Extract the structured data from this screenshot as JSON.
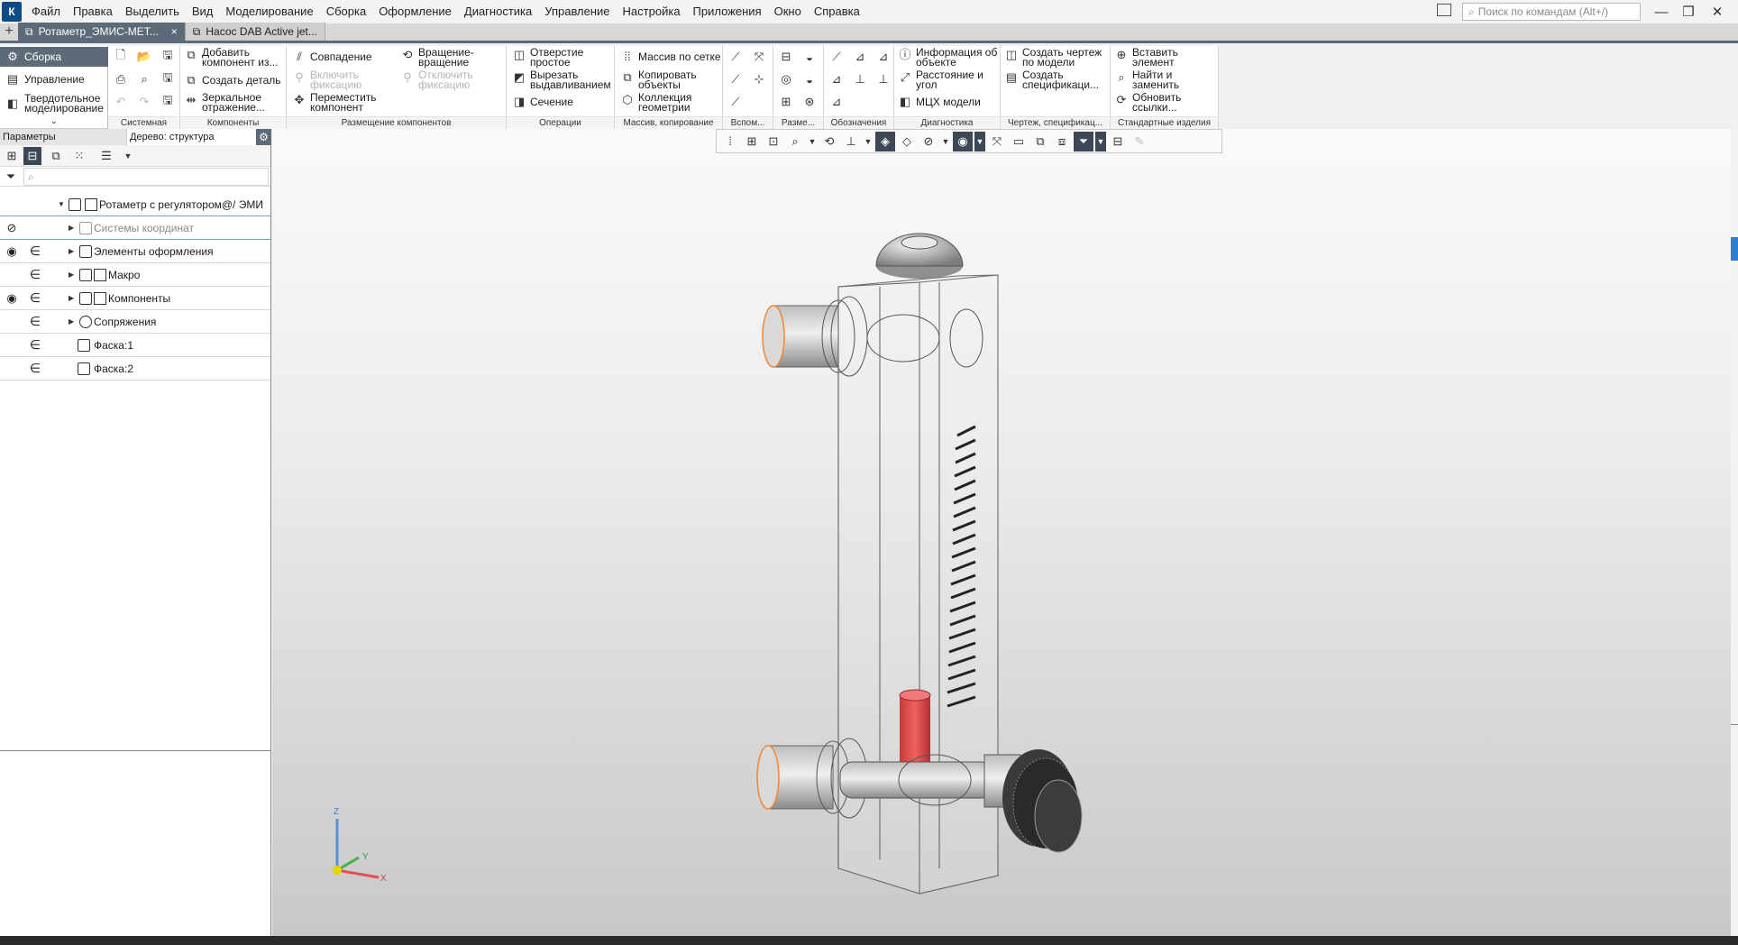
{
  "menubar": {
    "logo": "К",
    "items": [
      "Файл",
      "Правка",
      "Выделить",
      "Вид",
      "Моделирование",
      "Сборка",
      "Оформление",
      "Диагностика",
      "Управление",
      "Настройка",
      "Приложения",
      "Окно",
      "Справка"
    ],
    "search_placeholder": "Поиск по командам (Alt+/)"
  },
  "tabs": [
    {
      "label": "Ротаметр_ЭМИС-МЕТ...",
      "close": "×"
    },
    {
      "label": "Насос DAB Active jet..."
    }
  ],
  "left_tabs": [
    "Сборка",
    "Управление",
    "Твердотельное моделирование"
  ],
  "ribbon": {
    "groups": {
      "system": "Системная",
      "components": "Компоненты",
      "placement": "Размещение компонентов",
      "operations": "Операции",
      "arrays": "Массив, копирование",
      "aux": "Вспом...",
      "dims": "Разме...",
      "notes": "Обозначения",
      "diag": "Диагностика",
      "drawing": "Чертеж, спецификац...",
      "std": "Стандартные изделия"
    },
    "buttons": {
      "add_component_1": "Добавить",
      "add_component_2": "компонент из...",
      "create_part": "Создать деталь",
      "mirror_1": "Зеркальное",
      "mirror_2": "отражение...",
      "coincidence": "Совпадение",
      "rotate_1": "Вращение-",
      "rotate_2": "вращение",
      "enable_fix_1": "Включить",
      "enable_fix_2": "фиксацию",
      "disable_fix_1": "Отключить",
      "disable_fix_2": "фиксацию",
      "move_1": "Переместить",
      "move_2": "компонент",
      "hole_1": "Отверстие",
      "hole_2": "простое",
      "cut_1": "Вырезать",
      "cut_2": "выдавливанием",
      "section": "Сечение",
      "grid_array": "Массив по сетке",
      "copy_1": "Копировать",
      "copy_2": "объекты",
      "collection_1": "Коллекция",
      "collection_2": "геометрии",
      "info_1": "Информация об",
      "info_2": "объекте",
      "distance_1": "Расстояние и",
      "distance_2": "угол",
      "mcx": "МЦХ модели",
      "create_drawing_1": "Создать чертеж",
      "create_drawing_2": "по модели",
      "create_spec_1": "Создать",
      "create_spec_2": "спецификаци...",
      "insert_1": "Вставить",
      "insert_2": "элемент",
      "find_1": "Найти и",
      "find_2": "заменить",
      "update_1": "Обновить",
      "update_2": "ссылки..."
    }
  },
  "panel": {
    "params_label": "Параметры",
    "tree_label": "Дерево: структура",
    "root": "Ротаметр с регулятором@/ ЭМИ",
    "items": [
      {
        "label": "Системы координат",
        "eye": "hidden"
      },
      {
        "label": "Элементы оформления",
        "eye": "visible"
      },
      {
        "label": "Макро",
        "eye": "none"
      },
      {
        "label": "Компоненты",
        "eye": "visible"
      },
      {
        "label": "Сопряжения",
        "eye": "none"
      },
      {
        "label": "Фаска:1",
        "eye": "none"
      },
      {
        "label": "Фаска:2",
        "eye": "none"
      }
    ]
  },
  "axes": {
    "z": "Z",
    "y": "Y",
    "x": "X"
  },
  "colors": {
    "accent": "#5d6a78",
    "float": "#e04a4a",
    "nozzle_edge": "#f08a3c"
  }
}
